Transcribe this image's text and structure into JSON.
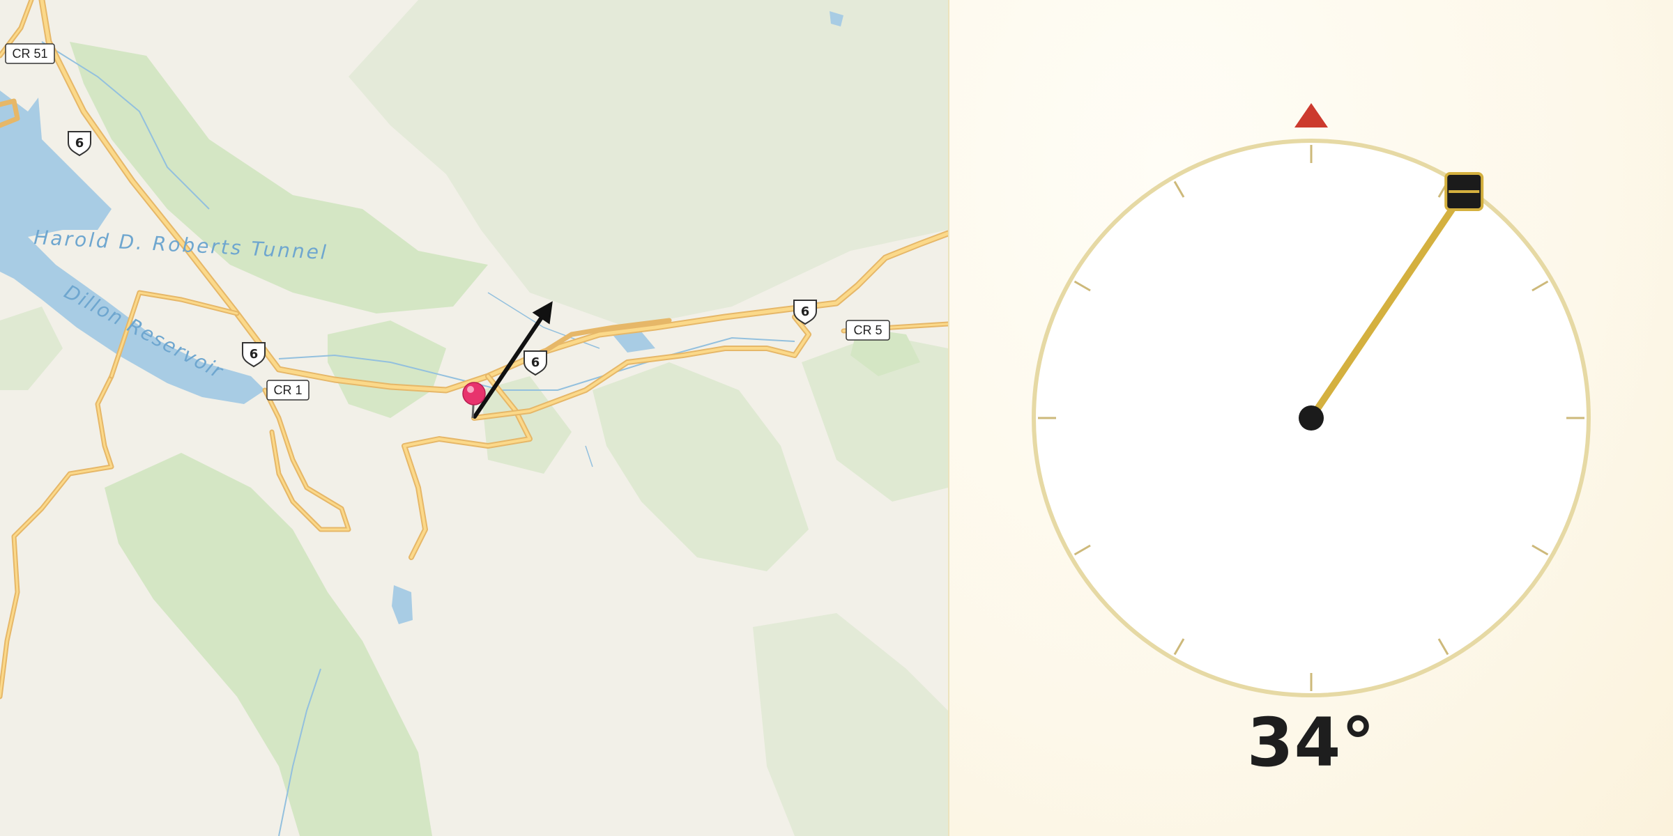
{
  "map": {
    "water_labels": {
      "tunnel": "Harold D. Roberts Tunnel",
      "reservoir": "Dillon Reservoir"
    },
    "route_shields": {
      "us6_a": "6",
      "us6_b": "6",
      "us6_c": "6",
      "us6_d": "6"
    },
    "county_roads": {
      "cr51": "CR 51",
      "cr1": "CR 1",
      "cr5": "CR 5"
    },
    "pin_color": "#e8336d",
    "arrow_color": "#111111",
    "heading_deg": 34
  },
  "compass": {
    "heading_deg": 34,
    "readout": "34°",
    "north_marker_color": "#cc3a2e",
    "needle_color": "#d4b03f",
    "ring_color": "#e6d9a4"
  }
}
